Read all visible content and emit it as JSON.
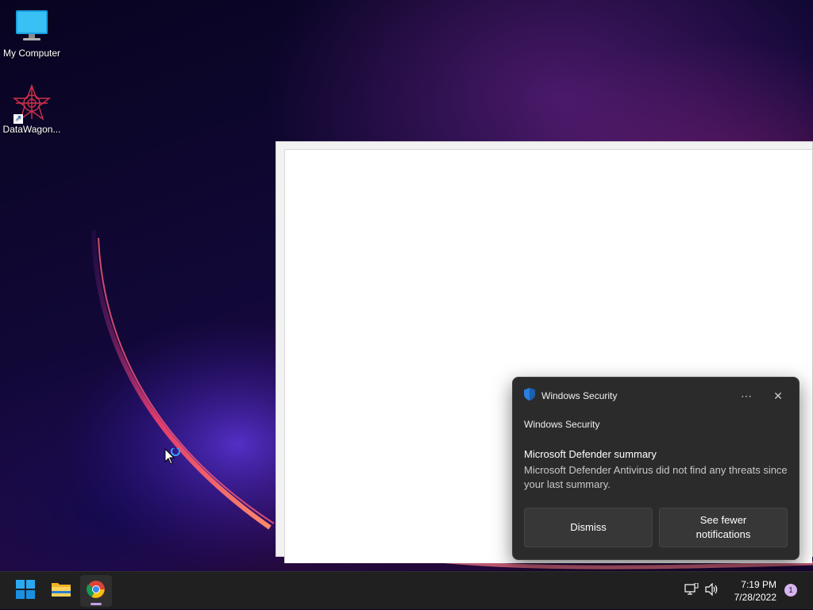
{
  "desktop": {
    "icons": [
      {
        "label": "My Computer",
        "icon": "monitor-icon"
      },
      {
        "label": "DataWagon...",
        "icon": "datawagon-icon"
      }
    ]
  },
  "toast": {
    "app_name": "Windows Security",
    "source": "Windows Security",
    "title": "Microsoft Defender summary",
    "body": "Microsoft Defender Antivirus did not find any threats since your last summary.",
    "more_icon": "ellipsis-icon",
    "close_icon": "close-icon",
    "buttons": {
      "dismiss": "Dismiss",
      "fewer_line1": "See fewer",
      "fewer_line2": "notifications"
    }
  },
  "taskbar": {
    "apps": [
      {
        "name": "start",
        "icon": "windows-logo-icon"
      },
      {
        "name": "file-explorer",
        "icon": "folder-icon"
      },
      {
        "name": "chrome",
        "icon": "chrome-icon",
        "active": true
      }
    ],
    "tray": {
      "network_icon": "network-icon",
      "volume_icon": "volume-icon",
      "time": "7:19 PM",
      "date": "7/28/2022",
      "notification_count": "1"
    }
  },
  "colors": {
    "accent": "#c6a1e6",
    "toast_bg": "#2b2b2b",
    "taskbar_bg": "#202020"
  }
}
